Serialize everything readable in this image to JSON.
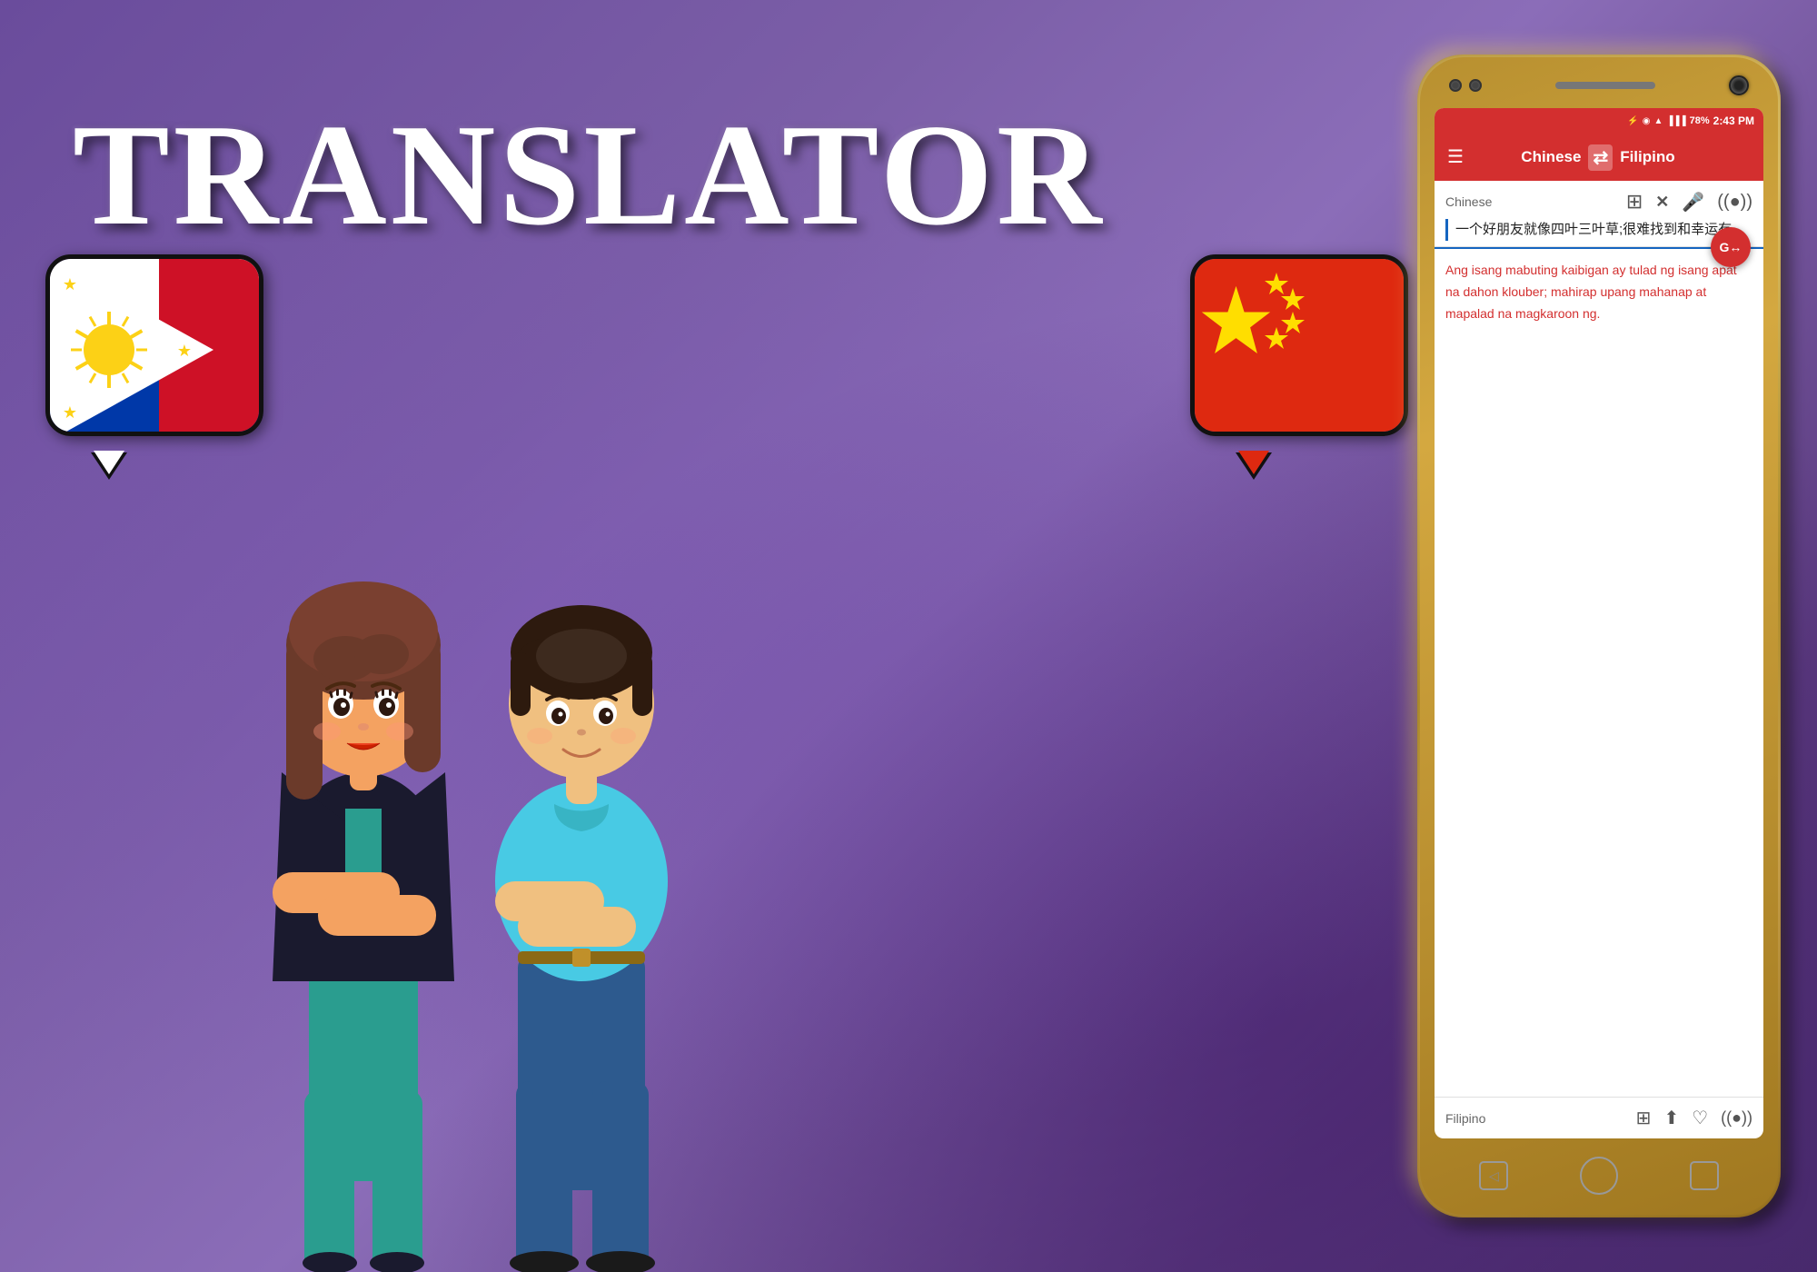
{
  "title": "TRANSLATOR",
  "background": {
    "gradient_start": "#6a4c9c",
    "gradient_end": "#4a2d6e"
  },
  "phone": {
    "status_bar": {
      "usb_icon": "⚡",
      "android_icon": "◉",
      "wifi_icon": "📶",
      "signal_icon": "📶",
      "battery": "78%",
      "time": "2:43 PM"
    },
    "app_bar": {
      "menu_icon": "☰",
      "source_lang": "Chinese",
      "swap_icon": "⇌",
      "target_lang": "Filipino"
    },
    "input": {
      "lang_label": "Chinese",
      "clipboard_icon": "📋",
      "clear_icon": "✕",
      "mic_icon": "🎤",
      "listen_icon": "🎧",
      "text": "一个好朋友就像四叶三叶草;很难找到和幸运有。"
    },
    "translate_button": {
      "icon": "G"
    },
    "output": {
      "lang_label": "Filipino",
      "text": "Ang isang mabuting kaibigan ay tulad ng isang apat na dahon klouber; mahirap upang mahanap at mapalad na magkaroon ng.",
      "copy_icon": "📋",
      "share_icon": "↑",
      "heart_icon": "♡",
      "listen_icon": "🎧"
    },
    "bottom_nav": {
      "back_icon": "◁",
      "home_icon": "○",
      "recent_icon": "□"
    }
  },
  "flags": {
    "philippines": "Philippine flag",
    "china": "Chinese flag"
  },
  "characters": {
    "female": "Cartoon female character",
    "male": "Cartoon male character"
  }
}
